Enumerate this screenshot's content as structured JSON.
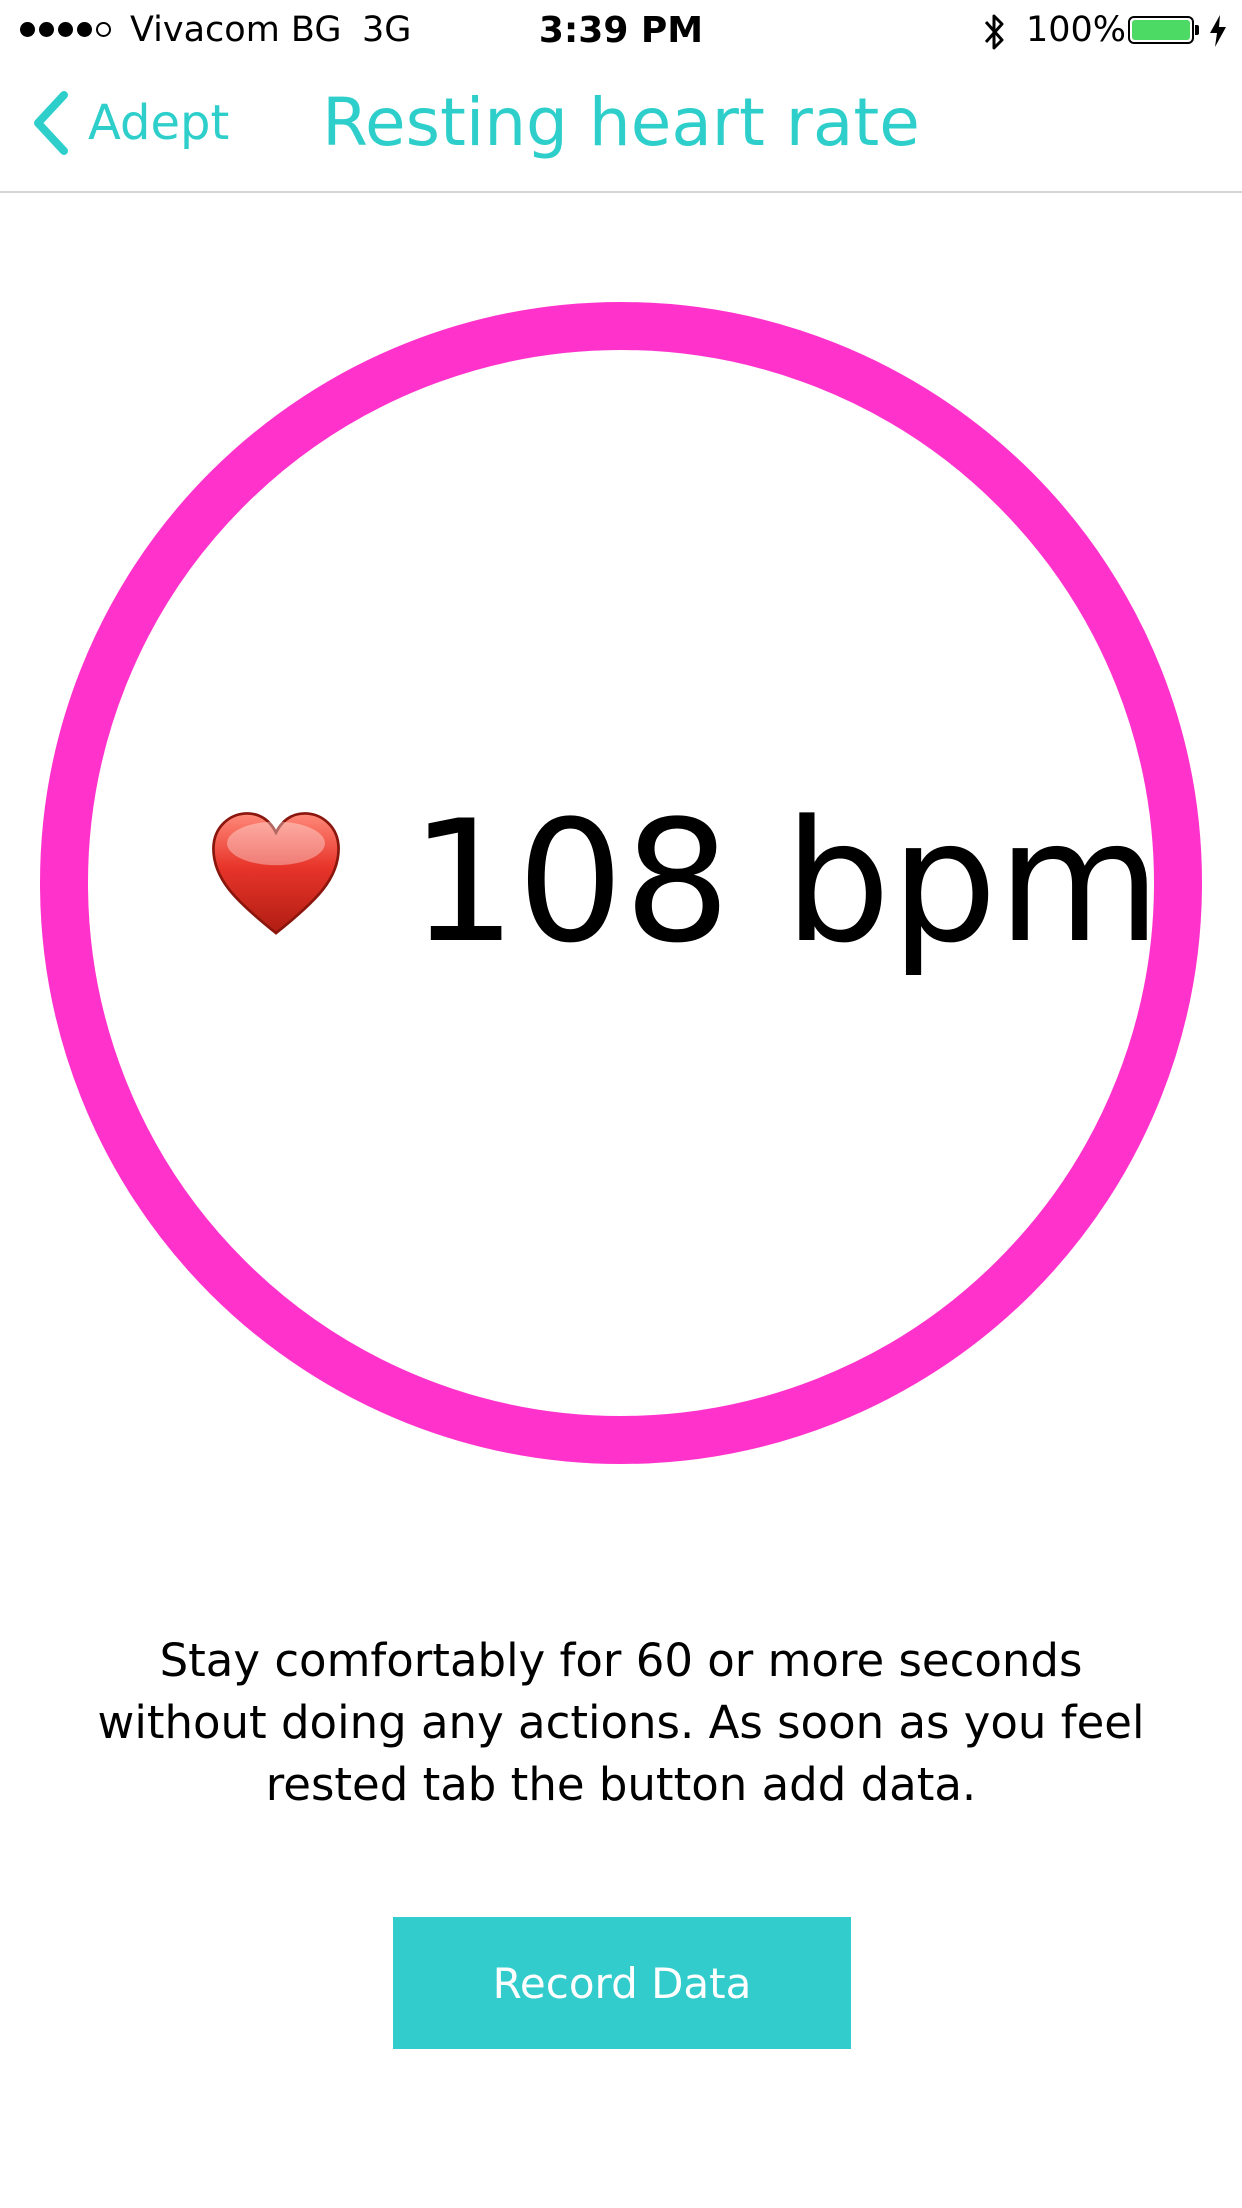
{
  "status_bar": {
    "signal_bars_filled": 4,
    "signal_bars_total": 5,
    "carrier": "Vivacom BG",
    "network": "3G",
    "time": "3:39 PM",
    "bluetooth_icon": "bluetooth-icon",
    "battery_percent": "100%",
    "battery_level": 1.0,
    "charging_icon": "bolt-icon"
  },
  "nav": {
    "back_label": "Adept",
    "back_icon": "chevron-left-icon",
    "title": "Resting heart rate"
  },
  "reading": {
    "icon": "heart-icon",
    "value_text": "108 bpm"
  },
  "instructions": "Stay comfortably for 60 or more seconds without doing any actions. As soon as you feel rested tab the button add data.",
  "record_button": {
    "label": "Record Data"
  },
  "colors": {
    "accent": "#2ecfcb",
    "ring": "#ff33cc",
    "button": "#33cccc",
    "battery": "#4cd964"
  }
}
